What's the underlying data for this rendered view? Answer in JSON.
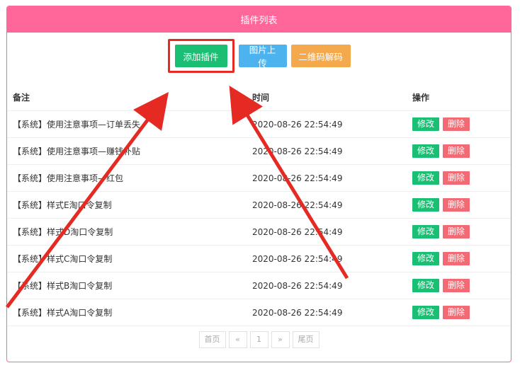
{
  "panel": {
    "title": "插件列表"
  },
  "toolbar": {
    "add_label": "添加插件",
    "upload_label": "图片上传",
    "decode_label": "二维码解码"
  },
  "table": {
    "headers": {
      "note": "备注",
      "time": "时间",
      "ops": "操作"
    },
    "edit_label": "修改",
    "delete_label": "删除",
    "rows": [
      {
        "note": "【系统】使用注意事项—订单丢失",
        "time": "2020-08-26 22:54:49"
      },
      {
        "note": "【系统】使用注意事项—赚钱补贴",
        "time": "2020-08-26 22:54:49"
      },
      {
        "note": "【系统】使用注意事项—红包",
        "time": "2020-08-26 22:54:49"
      },
      {
        "note": "【系统】样式E淘口令复制",
        "time": "2020-08-26 22:54:49"
      },
      {
        "note": "【系统】样式D淘口令复制",
        "time": "2020-08-26 22:54:49"
      },
      {
        "note": "【系统】样式C淘口令复制",
        "time": "2020-08-26 22:54:49"
      },
      {
        "note": "【系统】样式B淘口令复制",
        "time": "2020-08-26 22:54:49"
      },
      {
        "note": "【系统】样式A淘口令复制",
        "time": "2020-08-26 22:54:49"
      }
    ]
  },
  "pager": {
    "first": "首页",
    "prev": "«",
    "current": "1",
    "next": "»",
    "last": "尾页"
  },
  "colors": {
    "accent": "#ff6699",
    "add": "#1bbf73",
    "upload": "#4db3ee",
    "decode": "#f5a94d",
    "delete": "#f26b74",
    "annotation": "#e52a23"
  }
}
